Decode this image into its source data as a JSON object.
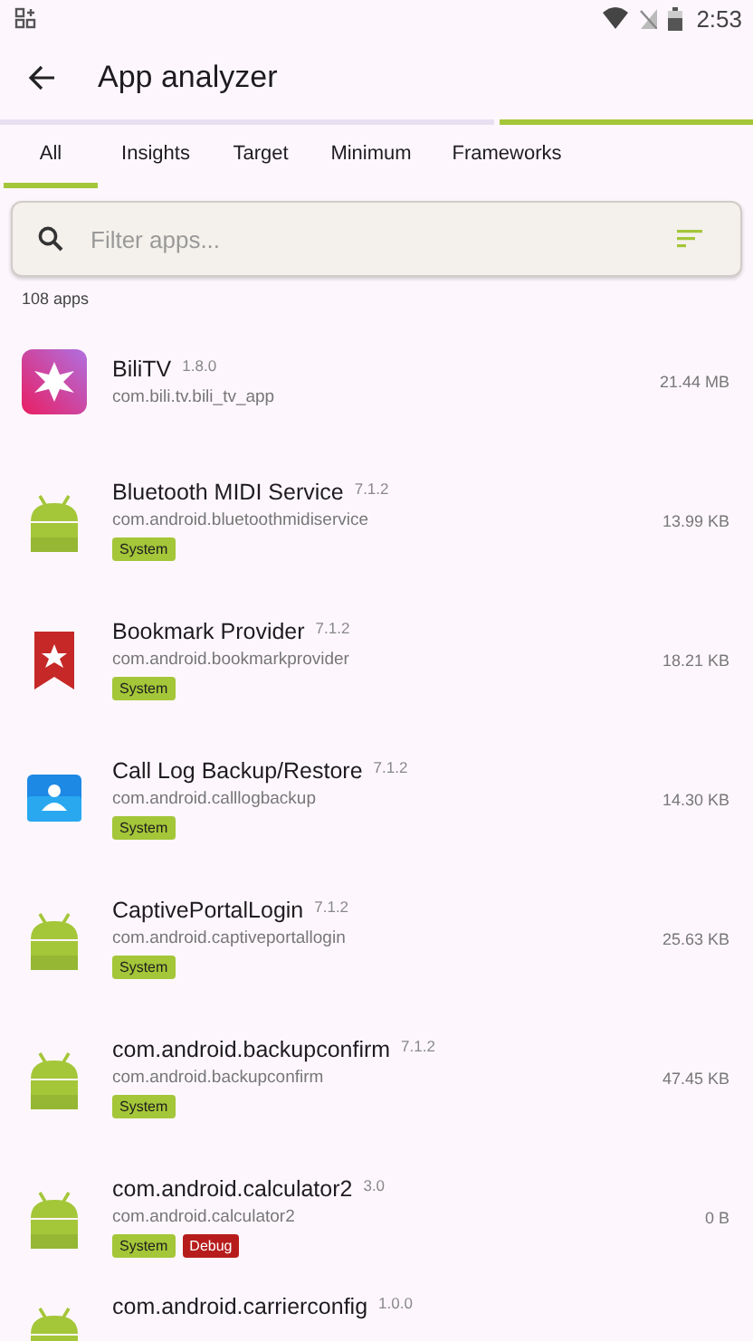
{
  "status_bar": {
    "time": "2:53"
  },
  "toolbar": {
    "title": "App analyzer"
  },
  "tabs": [
    {
      "label": "All",
      "selected": true
    },
    {
      "label": "Insights",
      "selected": false
    },
    {
      "label": "Target",
      "selected": false
    },
    {
      "label": "Minimum",
      "selected": false
    },
    {
      "label": "Frameworks",
      "selected": false
    }
  ],
  "search": {
    "placeholder": "Filter apps..."
  },
  "count": "108 apps",
  "apps": [
    {
      "kind": "logo",
      "name": "BiliTV",
      "version": "1.8.0",
      "package": "com.bili.tv.bili_tv_app",
      "size": "21.44 MB"
    },
    {
      "kind": "android",
      "name": "Bluetooth MIDI Service",
      "version": "7.1.2",
      "package": "com.android.bluetoothmidiservice",
      "size": "13.99 KB",
      "tags": [
        {
          "kind": "system",
          "label": "System"
        }
      ]
    },
    {
      "kind": "bookmark",
      "name": "Bookmark Provider",
      "version": "7.1.2",
      "package": "com.android.bookmarkprovider",
      "size": "18.21 KB",
      "tags": [
        {
          "kind": "system",
          "label": "System"
        }
      ]
    },
    {
      "kind": "contact",
      "name": "Call Log Backup/Restore",
      "version": "7.1.2",
      "package": "com.android.calllogbackup",
      "size": "14.30 KB",
      "tags": [
        {
          "kind": "system",
          "label": "System"
        }
      ]
    },
    {
      "kind": "android",
      "name": "CaptivePortalLogin",
      "version": "7.1.2",
      "package": "com.android.captiveportallogin",
      "size": "25.63 KB",
      "tags": [
        {
          "kind": "system",
          "label": "System"
        }
      ]
    },
    {
      "kind": "android",
      "name": "com.android.backupconfirm",
      "version": "7.1.2",
      "package": "com.android.backupconfirm",
      "size": "47.45 KB",
      "tags": [
        {
          "kind": "system",
          "label": "System"
        }
      ]
    },
    {
      "kind": "android",
      "name": "com.android.calculator2",
      "version": "3.0",
      "package": "com.android.calculator2",
      "size": "0 B",
      "tags": [
        {
          "kind": "system",
          "label": "System"
        },
        {
          "kind": "debug",
          "label": "Debug"
        }
      ]
    },
    {
      "kind": "android",
      "name": "com.android.carrierconfig",
      "version": "1.0.0"
    }
  ]
}
